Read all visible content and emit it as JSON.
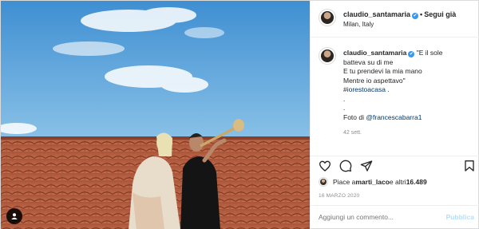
{
  "header": {
    "username": "claudio_santamaria",
    "verified_mark": "✔",
    "separator": "•",
    "follow_label": "Segui già",
    "location": "Milan, Italy"
  },
  "caption": {
    "username": "claudio_santamaria",
    "lines": [
      "\"E il sole",
      "batteva su di me",
      "E tu prendevi la mia mano",
      "Mentre io aspettavo\"",
      "#iorestoacasa",
      ".",
      ".",
      "Foto di",
      "@francescabarra1"
    ],
    "hashtag_trailing": " .",
    "time_ago": "42 sett."
  },
  "actions": {
    "icons": [
      "heart-icon",
      "comment-icon",
      "share-icon",
      "bookmark-icon"
    ]
  },
  "likes": {
    "prefix": "Piace a ",
    "user": "marti_laco",
    "middle": " e altri ",
    "count": "16.489"
  },
  "date": "16 MARZO 2020",
  "add_comment": {
    "placeholder": "Aggiungi un commento...",
    "publish_label": "Pubblica"
  },
  "colors": {
    "sky": "#5fa6d8",
    "roof": "#b55a3d",
    "link": "#00376b",
    "publish_disabled": "#b2dffc",
    "verified": "#3897f0"
  }
}
